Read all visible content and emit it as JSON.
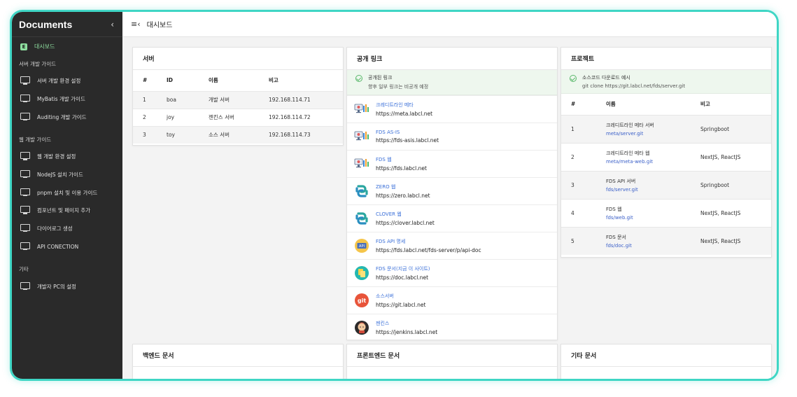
{
  "sidebar": {
    "title": "Documents",
    "collapse_icon": "chevron-left-icon",
    "active_item": {
      "badge": "E",
      "label": "대시보드"
    },
    "sections": [
      {
        "label": "서버 개발 가이드",
        "items": [
          "서버 개발 환경 설정",
          "MyBatis 개발 가이드",
          "Auditing 개발 가이드"
        ]
      },
      {
        "label": "웹 개발 가이드",
        "items": [
          "웹 개발 환경 설정",
          "NodeJS 설치 가이드",
          "pnpm 설치 및 이용 가이드",
          "컴포넌트 및 페이지 추가",
          "다이어로그 생성",
          "API CONECTION"
        ]
      },
      {
        "label": "기타",
        "items": [
          "개발자 PC의 설정"
        ]
      }
    ]
  },
  "header": {
    "menu_icon": "menu-collapse-icon",
    "title": "대시보드"
  },
  "server_card": {
    "title": "서버",
    "columns": [
      "#",
      "ID",
      "이름",
      "비고"
    ],
    "rows": [
      [
        "1",
        "boa",
        "개발 서버",
        "192.168.114.71"
      ],
      [
        "2",
        "joy",
        "젠킨스 서버",
        "192.168.114.72"
      ],
      [
        "3",
        "toy",
        "소스 서버",
        "192.168.114.73"
      ]
    ]
  },
  "links_card": {
    "title": "공개 링크",
    "notice": {
      "title": "공개된 링크",
      "text": "향후 일부 링크는 비공개 예정"
    },
    "items": [
      {
        "name": "크레디트라인 메타",
        "url": "https://meta.labcl.net",
        "icon": "monitor-chart-icon"
      },
      {
        "name": "FDS AS-IS",
        "url": "https://fds-asis.labcl.net",
        "icon": "monitor-chart-icon"
      },
      {
        "name": "FDS 웹",
        "url": "https://fds.labcl.net",
        "icon": "monitor-chart-icon"
      },
      {
        "name": "ZERO 웹",
        "url": "https://zero.labcl.net",
        "icon": "knot-logo-icon"
      },
      {
        "name": "CLOVER 웹",
        "url": "https://clover.labcl.net",
        "icon": "knot-logo-icon"
      },
      {
        "name": "FDS API 명세",
        "url": "https://fds.labcl.net/fds-server/p/api-doc",
        "icon": "api-doc-icon"
      },
      {
        "name": "FDS 문서(지금 이 사이트)",
        "url": "https://doc.labcl.net",
        "icon": "documents-icon"
      },
      {
        "name": "소스서버",
        "url": "https://git.labcl.net",
        "icon": "git-logo-icon"
      },
      {
        "name": "젠킨스",
        "url": "https://jenkins.labcl.net",
        "icon": "jenkins-logo-icon"
      }
    ],
    "git_label": "git",
    "api_label": "API"
  },
  "project_card": {
    "title": "프로젝트",
    "notice": {
      "title": "소스코드 다운로드 예시",
      "text": "git clone https://git.labcl.net/fds/server.git"
    },
    "columns": [
      "#",
      "이름",
      "비고"
    ],
    "rows": [
      {
        "num": "1",
        "name": "크레디트라인 메타 서버",
        "repo": "meta/server.git",
        "note": "Springboot"
      },
      {
        "num": "2",
        "name": "크레디트라인 메타 웹",
        "repo": "meta/meta-web.git",
        "note": "NextJS, ReactJS"
      },
      {
        "num": "3",
        "name": "FDS API 서버",
        "repo": "fds/server.git",
        "note": "Springboot"
      },
      {
        "num": "4",
        "name": "FDS 웹",
        "repo": "fds/web.git",
        "note": "NextJS, ReactJS"
      },
      {
        "num": "5",
        "name": "FDS 문서",
        "repo": "fds/doc.git",
        "note": "NextJS, ReactJS"
      }
    ]
  },
  "bottom_cards": {
    "backend": "백엔드 문서",
    "frontend": "프론트엔드 문서",
    "other": "기타 문서"
  },
  "colors": {
    "accent_frame": "#3fd6c5",
    "sidebar_bg": "#2a2a2a",
    "active_green": "#8fe0a0",
    "link_blue": "#3a6fd8",
    "notice_bg": "#eef7ee"
  }
}
